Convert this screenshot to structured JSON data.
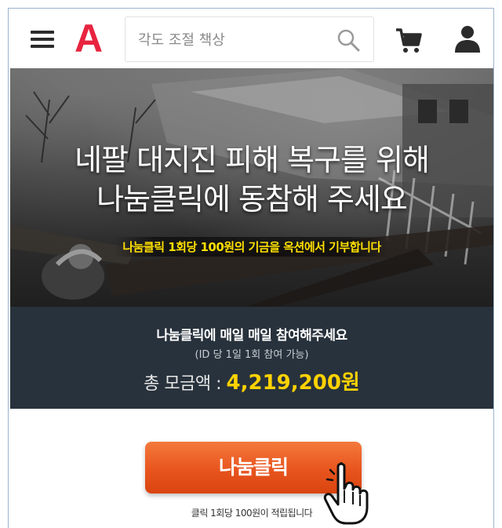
{
  "header": {
    "logo_text": "A",
    "search": {
      "placeholder": "각도 조절 책상"
    },
    "icons": [
      "menu-icon",
      "search-icon",
      "cart-icon",
      "user-icon"
    ]
  },
  "banner": {
    "title_line1": "네팔 대지진 피해 복구를 위해",
    "title_line2": "나눔클릭에 동참해 주세요",
    "subtitle": "나눔클릭 1회당 100원의 기금을 옥션에서 기부합니다"
  },
  "info": {
    "title": "나눔클릭에 매일 매일 참여해주세요",
    "note": "(ID 당 1일 1회 참여 가능)",
    "total_label": "총 모금액 : ",
    "total_value": "4,219,200원"
  },
  "cta": {
    "button_label": "나눔클릭",
    "note": "클릭 1회당 100원이 적립됩니다"
  },
  "colors": {
    "brand_red": "#e8243f",
    "panel_bg": "#28323c",
    "amount_yellow": "#ffd200",
    "button_orange": "#e8541e",
    "subtitle_yellow": "#ffe000"
  }
}
